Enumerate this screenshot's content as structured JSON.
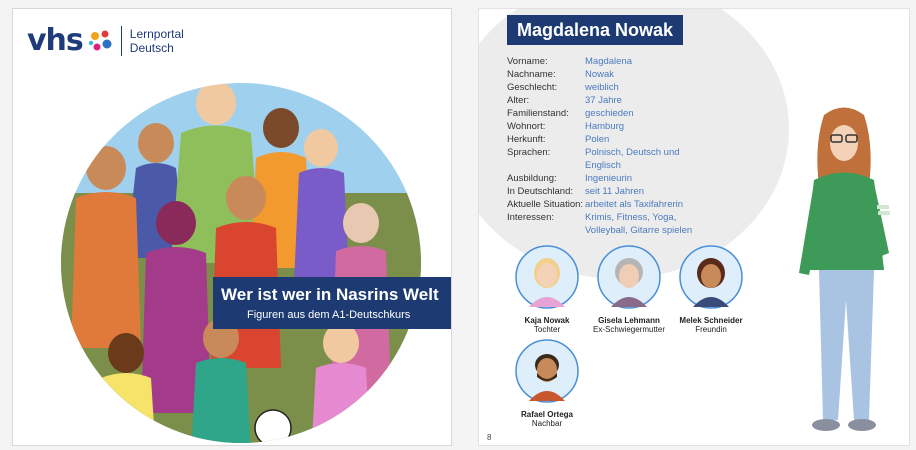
{
  "cover": {
    "logo_vhs": "vhs",
    "logo_line1": "Lernportal",
    "logo_line2": "Deutsch",
    "title": "Wer ist wer in Nasrins Welt",
    "subtitle": "Figuren aus dem A1-Deutschkurs"
  },
  "profile": {
    "name": "Magdalena Nowak",
    "details": [
      {
        "label": "Vorname:",
        "value": "Magdalena"
      },
      {
        "label": "Nachname:",
        "value": "Nowak"
      },
      {
        "label": "Geschlecht:",
        "value": "weiblich"
      },
      {
        "label": "Alter:",
        "value": "37 Jahre"
      },
      {
        "label": "Familienstand:",
        "value": "geschieden"
      },
      {
        "label": "Wohnort:",
        "value": "Hamburg"
      },
      {
        "label": "Herkunft:",
        "value": "Polen"
      },
      {
        "label": "Sprachen:",
        "value": "Polnisch, Deutsch und Englisch"
      },
      {
        "label": "Ausbildung:",
        "value": "Ingenieurin"
      },
      {
        "label": "In Deutschland:",
        "value": "seit 11 Jahren"
      },
      {
        "label": "Aktuelle Situation:",
        "value": "arbeitet als Taxifahrerin"
      },
      {
        "label": "Interessen:",
        "value": "Krimis, Fitness, Yoga, Volleyball, Gitarre spielen"
      }
    ],
    "relations": [
      {
        "name": "Kaja Nowak",
        "role": "Tochter"
      },
      {
        "name": "Gisela Lehmann",
        "role": "Ex-Schwiegermutter"
      },
      {
        "name": "Melek Schneider",
        "role": "Freundin"
      },
      {
        "name": "Rafael Ortega",
        "role": "Nachbar"
      }
    ],
    "page_number": "8"
  },
  "colors": {
    "brand_navy": "#1d3a72",
    "value_blue": "#4a7bbf",
    "circle_blue": "#9fd0ee"
  }
}
